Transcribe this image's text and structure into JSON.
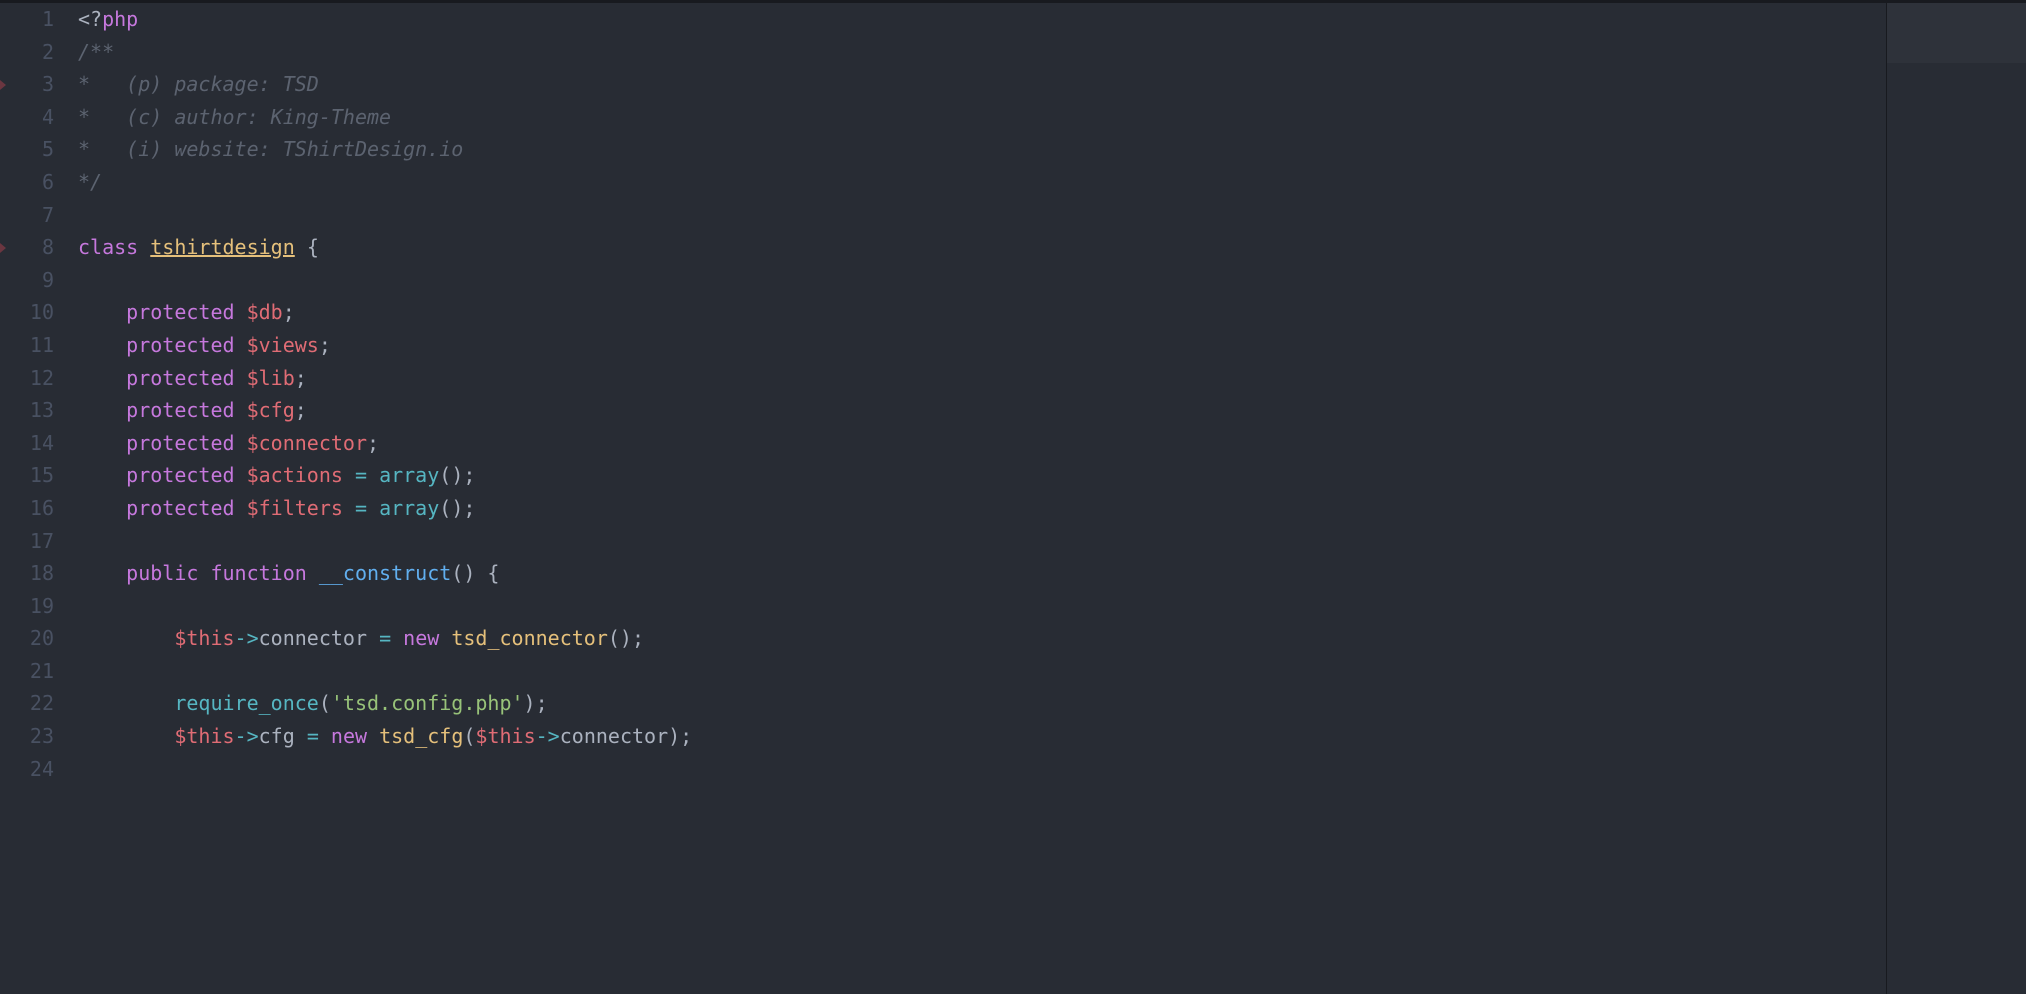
{
  "editor": {
    "gutterMarks": [
      3,
      8
    ],
    "lines": [
      {
        "num": "1",
        "tokens": [
          {
            "cls": "tok-php-tag",
            "t": "<?"
          },
          {
            "cls": "tok-keyword",
            "t": "php"
          }
        ]
      },
      {
        "num": "2",
        "tokens": [
          {
            "cls": "tok-comment",
            "t": "/**"
          }
        ]
      },
      {
        "num": "3",
        "tokens": [
          {
            "cls": "tok-comment",
            "t": "*   (p) package: TSD"
          }
        ]
      },
      {
        "num": "4",
        "tokens": [
          {
            "cls": "tok-comment",
            "t": "*   (c) author: King-Theme"
          }
        ]
      },
      {
        "num": "5",
        "tokens": [
          {
            "cls": "tok-comment",
            "t": "*   (i) website: TShirtDesign.io"
          }
        ]
      },
      {
        "num": "6",
        "tokens": [
          {
            "cls": "tok-comment",
            "t": "*/"
          }
        ]
      },
      {
        "num": "7",
        "tokens": []
      },
      {
        "num": "8",
        "tokens": [
          {
            "cls": "tok-keyword",
            "t": "class"
          },
          {
            "cls": "tok-plain",
            "t": " "
          },
          {
            "cls": "tok-class",
            "t": "tshirtdesign"
          },
          {
            "cls": "tok-plain",
            "t": " "
          },
          {
            "cls": "tok-punct",
            "t": "{"
          }
        ]
      },
      {
        "num": "9",
        "tokens": []
      },
      {
        "num": "10",
        "tokens": [
          {
            "cls": "tok-plain",
            "t": "    "
          },
          {
            "cls": "tok-keyword",
            "t": "protected"
          },
          {
            "cls": "tok-plain",
            "t": " "
          },
          {
            "cls": "tok-var",
            "t": "$db"
          },
          {
            "cls": "tok-punct",
            "t": ";"
          }
        ]
      },
      {
        "num": "11",
        "tokens": [
          {
            "cls": "tok-plain",
            "t": "    "
          },
          {
            "cls": "tok-keyword",
            "t": "protected"
          },
          {
            "cls": "tok-plain",
            "t": " "
          },
          {
            "cls": "tok-var",
            "t": "$views"
          },
          {
            "cls": "tok-punct",
            "t": ";"
          }
        ]
      },
      {
        "num": "12",
        "tokens": [
          {
            "cls": "tok-plain",
            "t": "    "
          },
          {
            "cls": "tok-keyword",
            "t": "protected"
          },
          {
            "cls": "tok-plain",
            "t": " "
          },
          {
            "cls": "tok-var",
            "t": "$lib"
          },
          {
            "cls": "tok-punct",
            "t": ";"
          }
        ]
      },
      {
        "num": "13",
        "tokens": [
          {
            "cls": "tok-plain",
            "t": "    "
          },
          {
            "cls": "tok-keyword",
            "t": "protected"
          },
          {
            "cls": "tok-plain",
            "t": " "
          },
          {
            "cls": "tok-var",
            "t": "$cfg"
          },
          {
            "cls": "tok-punct",
            "t": ";"
          }
        ]
      },
      {
        "num": "14",
        "tokens": [
          {
            "cls": "tok-plain",
            "t": "    "
          },
          {
            "cls": "tok-keyword",
            "t": "protected"
          },
          {
            "cls": "tok-plain",
            "t": " "
          },
          {
            "cls": "tok-var",
            "t": "$connector"
          },
          {
            "cls": "tok-punct",
            "t": ";"
          }
        ]
      },
      {
        "num": "15",
        "tokens": [
          {
            "cls": "tok-plain",
            "t": "    "
          },
          {
            "cls": "tok-keyword",
            "t": "protected"
          },
          {
            "cls": "tok-plain",
            "t": " "
          },
          {
            "cls": "tok-var",
            "t": "$actions"
          },
          {
            "cls": "tok-plain",
            "t": " "
          },
          {
            "cls": "tok-op",
            "t": "="
          },
          {
            "cls": "tok-plain",
            "t": " "
          },
          {
            "cls": "tok-builtin",
            "t": "array"
          },
          {
            "cls": "tok-punct",
            "t": "();"
          }
        ]
      },
      {
        "num": "16",
        "tokens": [
          {
            "cls": "tok-plain",
            "t": "    "
          },
          {
            "cls": "tok-keyword",
            "t": "protected"
          },
          {
            "cls": "tok-plain",
            "t": " "
          },
          {
            "cls": "tok-var",
            "t": "$filters"
          },
          {
            "cls": "tok-plain",
            "t": " "
          },
          {
            "cls": "tok-op",
            "t": "="
          },
          {
            "cls": "tok-plain",
            "t": " "
          },
          {
            "cls": "tok-builtin",
            "t": "array"
          },
          {
            "cls": "tok-punct",
            "t": "();"
          }
        ]
      },
      {
        "num": "17",
        "tokens": []
      },
      {
        "num": "18",
        "tokens": [
          {
            "cls": "tok-plain",
            "t": "    "
          },
          {
            "cls": "tok-keyword",
            "t": "public"
          },
          {
            "cls": "tok-plain",
            "t": " "
          },
          {
            "cls": "tok-keyword",
            "t": "function"
          },
          {
            "cls": "tok-plain",
            "t": " "
          },
          {
            "cls": "tok-func",
            "t": "__construct"
          },
          {
            "cls": "tok-punct",
            "t": "() {"
          }
        ]
      },
      {
        "num": "19",
        "tokens": []
      },
      {
        "num": "20",
        "tokens": [
          {
            "cls": "tok-plain",
            "t": "        "
          },
          {
            "cls": "tok-var",
            "t": "$this"
          },
          {
            "cls": "tok-op",
            "t": "->"
          },
          {
            "cls": "tok-prop",
            "t": "connector "
          },
          {
            "cls": "tok-op",
            "t": "="
          },
          {
            "cls": "tok-plain",
            "t": " "
          },
          {
            "cls": "tok-keyword",
            "t": "new"
          },
          {
            "cls": "tok-plain",
            "t": " "
          },
          {
            "cls": "tok-class-plain",
            "t": "tsd_connector"
          },
          {
            "cls": "tok-punct",
            "t": "();"
          }
        ]
      },
      {
        "num": "21",
        "tokens": []
      },
      {
        "num": "22",
        "tokens": [
          {
            "cls": "tok-plain",
            "t": "        "
          },
          {
            "cls": "tok-builtin",
            "t": "require_once"
          },
          {
            "cls": "tok-punct",
            "t": "("
          },
          {
            "cls": "tok-string",
            "t": "'tsd.config.php'"
          },
          {
            "cls": "tok-punct",
            "t": ");"
          }
        ]
      },
      {
        "num": "23",
        "tokens": [
          {
            "cls": "tok-plain",
            "t": "        "
          },
          {
            "cls": "tok-var",
            "t": "$this"
          },
          {
            "cls": "tok-op",
            "t": "->"
          },
          {
            "cls": "tok-prop",
            "t": "cfg "
          },
          {
            "cls": "tok-op",
            "t": "="
          },
          {
            "cls": "tok-plain",
            "t": " "
          },
          {
            "cls": "tok-keyword",
            "t": "new"
          },
          {
            "cls": "tok-plain",
            "t": " "
          },
          {
            "cls": "tok-class-plain",
            "t": "tsd_cfg"
          },
          {
            "cls": "tok-punct",
            "t": "("
          },
          {
            "cls": "tok-var",
            "t": "$this"
          },
          {
            "cls": "tok-op",
            "t": "->"
          },
          {
            "cls": "tok-prop",
            "t": "connector"
          },
          {
            "cls": "tok-punct",
            "t": ");"
          }
        ]
      },
      {
        "num": "24",
        "tokens": []
      }
    ]
  }
}
